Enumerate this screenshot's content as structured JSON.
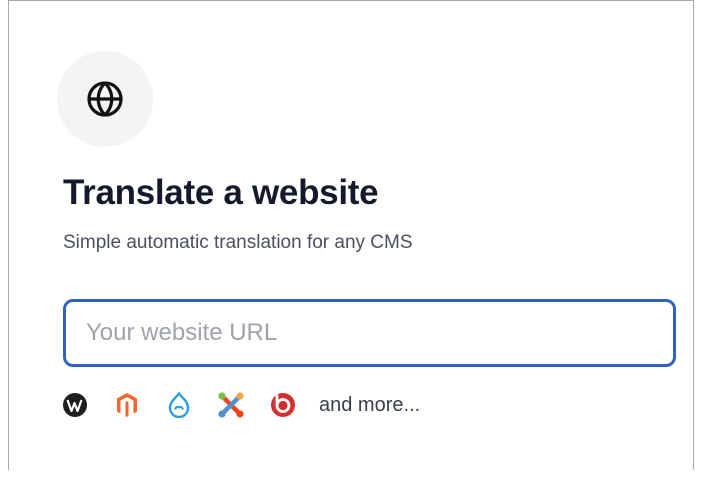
{
  "card": {
    "icon": "globe-icon",
    "title": "Translate a website",
    "subtitle": "Simple automatic translation for any CMS"
  },
  "url_input": {
    "placeholder": "Your website URL",
    "value": ""
  },
  "cms_list": {
    "icons": [
      {
        "name": "wordpress-icon",
        "color": "#1e1e1e"
      },
      {
        "name": "magento-icon",
        "color": "#ee672f"
      },
      {
        "name": "drupal-icon",
        "color": "#2b9fe0"
      },
      {
        "name": "joomla-icon",
        "colors": [
          "#f44321",
          "#5091cd",
          "#7ac143",
          "#f9a541"
        ]
      },
      {
        "name": "bitrix-icon",
        "color": "#d52e2e"
      }
    ],
    "more_label": "and more..."
  },
  "colors": {
    "accent_border": "#2f62c3",
    "title": "#141a2b",
    "icon_bg": "#f3f4f6"
  }
}
